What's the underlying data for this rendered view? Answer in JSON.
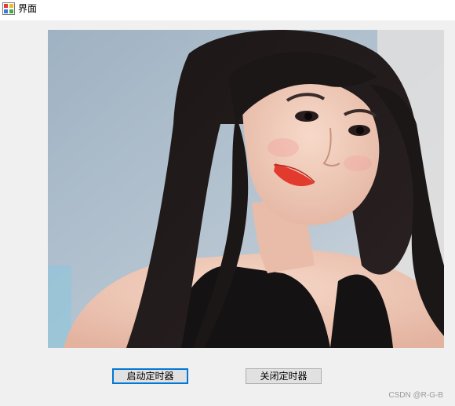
{
  "window": {
    "title": "界面",
    "icon": "winforms-app-icon"
  },
  "picture": {
    "icon": "photo-portrait"
  },
  "buttons": {
    "start_timer": "启动定时器",
    "stop_timer": "关闭定时器"
  },
  "watermark": "CSDN @R-G-B",
  "colors": {
    "form_background": "#f0f0f0",
    "button_background": "#e1e1e1",
    "button_focus_border": "#0078d7"
  }
}
